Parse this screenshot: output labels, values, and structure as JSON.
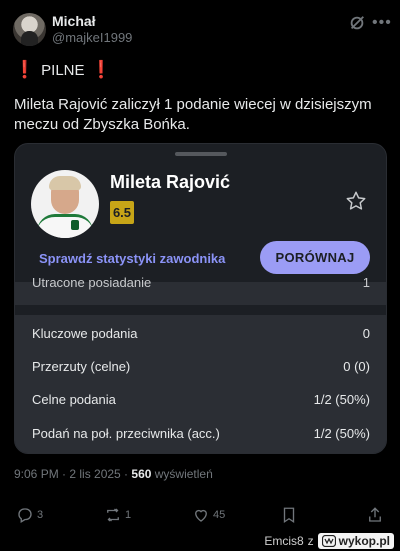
{
  "author": {
    "name": "Michał",
    "handle": "@majkeI1999"
  },
  "tweet": {
    "headline": "PILNE",
    "exclamation": "❗",
    "body": "Mileta Rajović zaliczył 1 podanie wiecej w dzisiejszym meczu od Zbyszka Bońka."
  },
  "card": {
    "player_name": "Mileta Rajović",
    "rating": "6.5",
    "stats_link": "Sprawdź statystyki zawodnika",
    "compare_button": "PORÓWNAJ",
    "partial_row": {
      "label": "Utracone posiadanie",
      "value": "1"
    },
    "stats": [
      {
        "label": "Kluczowe podania",
        "value": "0"
      },
      {
        "label": "Przerzuty (celne)",
        "value": "0 (0)"
      },
      {
        "label": "Celne podania",
        "value": "1/2 (50%)"
      },
      {
        "label": "Podań na poł. przeciwnika (acc.)",
        "value": "1/2 (50%)"
      }
    ],
    "colors": {
      "rating_bg": "#c7a517",
      "accent": "#9b9cf5"
    }
  },
  "meta": {
    "time_date": "9:06 PM · 2 lis 2025 · ",
    "views_count": "560",
    "views_label": " wyświetleń"
  },
  "actions": {
    "replies": "3",
    "reposts": "1",
    "likes": "45"
  },
  "watermark": {
    "text": "Emcis8",
    "suffix": "z",
    "site": "wykop.pl"
  }
}
